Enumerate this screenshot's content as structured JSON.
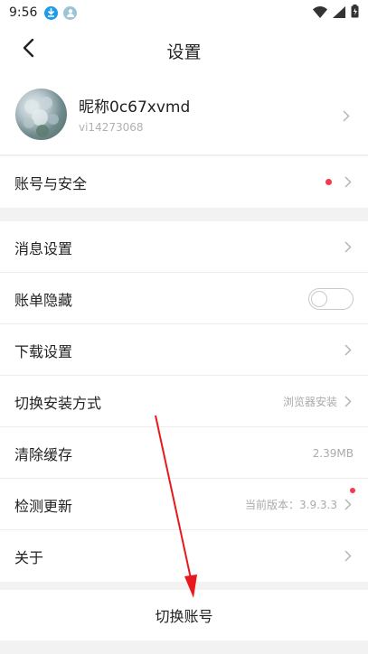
{
  "status_bar": {
    "time": "9:56",
    "icons": [
      "download-notification-icon",
      "avatar-notification-icon",
      "wifi-icon",
      "signal-icon",
      "battery-icon"
    ]
  },
  "header": {
    "title": "设置",
    "back_icon": "chevron-left-icon"
  },
  "profile": {
    "nickname": "昵称0c67xvmd",
    "user_id": "vi14273068"
  },
  "section1": {
    "account_security": {
      "label": "账号与安全",
      "has_dot": true
    }
  },
  "section2": {
    "items": [
      {
        "label": "消息设置",
        "value": ""
      },
      {
        "label": "账单隐藏",
        "toggle": false
      },
      {
        "label": "下载设置",
        "value": ""
      },
      {
        "label": "切换安装方式",
        "value": "浏览器安装"
      },
      {
        "label": "清除缓存",
        "value": "2.39MB"
      },
      {
        "label": "检测更新",
        "value": "当前版本：3.9.3.3",
        "has_dot": true
      },
      {
        "label": "关于",
        "value": ""
      }
    ]
  },
  "switch_account": {
    "label": "切换账号"
  },
  "colors": {
    "accent_red": "#f2394e",
    "annotation_red": "#e8191d",
    "background": "#f2f2f2"
  }
}
